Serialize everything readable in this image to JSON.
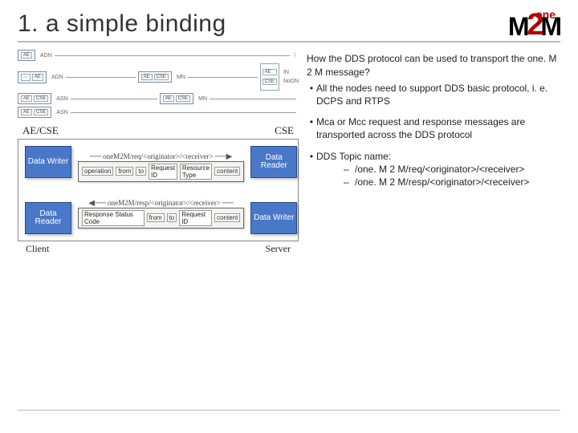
{
  "title": "1. a simple binding",
  "logo": {
    "one": "one",
    "m": "M",
    "two": "2",
    "m2": "M"
  },
  "arch": {
    "rows": [
      {
        "node": "ADN",
        "chips": [
          "AE"
        ]
      },
      {
        "node": "ADN",
        "chips": [
          "AE"
        ]
      },
      {
        "node": "ASN",
        "chips": [
          "AE",
          "CSE"
        ],
        "mn": {
          "label": "MN",
          "chips": [
            "AE",
            "CSE"
          ]
        }
      },
      {
        "node": "ASN",
        "chips": [
          "AE",
          "CSE"
        ]
      }
    ],
    "in": {
      "label": "IN",
      "chips": [
        "AE",
        "CSE"
      ]
    },
    "nodn": "NoDN"
  },
  "text": {
    "q1": "How the DDS protocol can be used to transport the one. M 2 M message?",
    "b1": "All the nodes need to support DDS basic protocol, i. e. DCPS and RTPS",
    "b2": "Mca or Mcc request and response messages are transported across the DDS protocol",
    "b3": "DDS Topic name:",
    "s1": "/one. M 2 M/req/<originator>/<receiver>",
    "s2": "/one. M 2 M/resp/<originator>/<receiver>"
  },
  "cs": {
    "left_title": "AE/CSE",
    "right_title": "CSE",
    "writer": "Data Writer",
    "reader": "Data Reader",
    "req_path": "oneM2M/req/<originator>/<receiver>",
    "req_cells": [
      "operation",
      "from",
      "to",
      "Request ID",
      "Resource Type",
      "content"
    ],
    "resp_path": "oneM2M/resp/<originator>/<receiver>",
    "resp_cells": [
      "Response Status Code",
      "from",
      "to",
      "Request ID",
      "content"
    ],
    "client": "Client",
    "server": "Server"
  }
}
